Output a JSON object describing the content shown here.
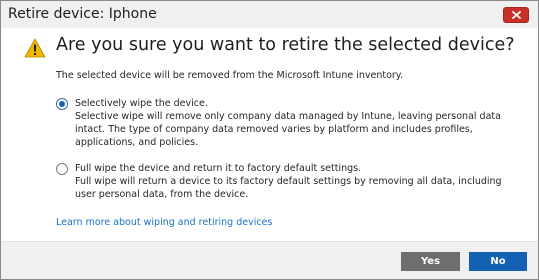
{
  "window": {
    "title": "Retire device: Iphone",
    "close_icon": "close-icon"
  },
  "dialog": {
    "warning_icon": "warning-icon",
    "heading": "Are you sure you want to retire the selected device?",
    "intro": "The selected device will be removed from the Microsoft Intune inventory.",
    "options": [
      {
        "title": "Selectively wipe the device.",
        "description": "Selective wipe will remove only company data managed by Intune, leaving personal data intact. The type of company data removed varies by platform and includes profiles, applications, and policies.",
        "selected": true
      },
      {
        "title": "Full wipe the device and return it to factory default settings.",
        "description": "Full wipe will return a device to its factory default settings by removing all data, including user personal data, from the device.",
        "selected": false
      }
    ],
    "learn_more_link": "Learn more about wiping and retiring devices"
  },
  "footer": {
    "yes_label": "Yes",
    "no_label": "No"
  },
  "colors": {
    "primary_button": "#1461b4",
    "secondary_button": "#6e6e6e",
    "close_button": "#c7312a",
    "warning": "#f2b600",
    "link": "#1a73c8"
  }
}
